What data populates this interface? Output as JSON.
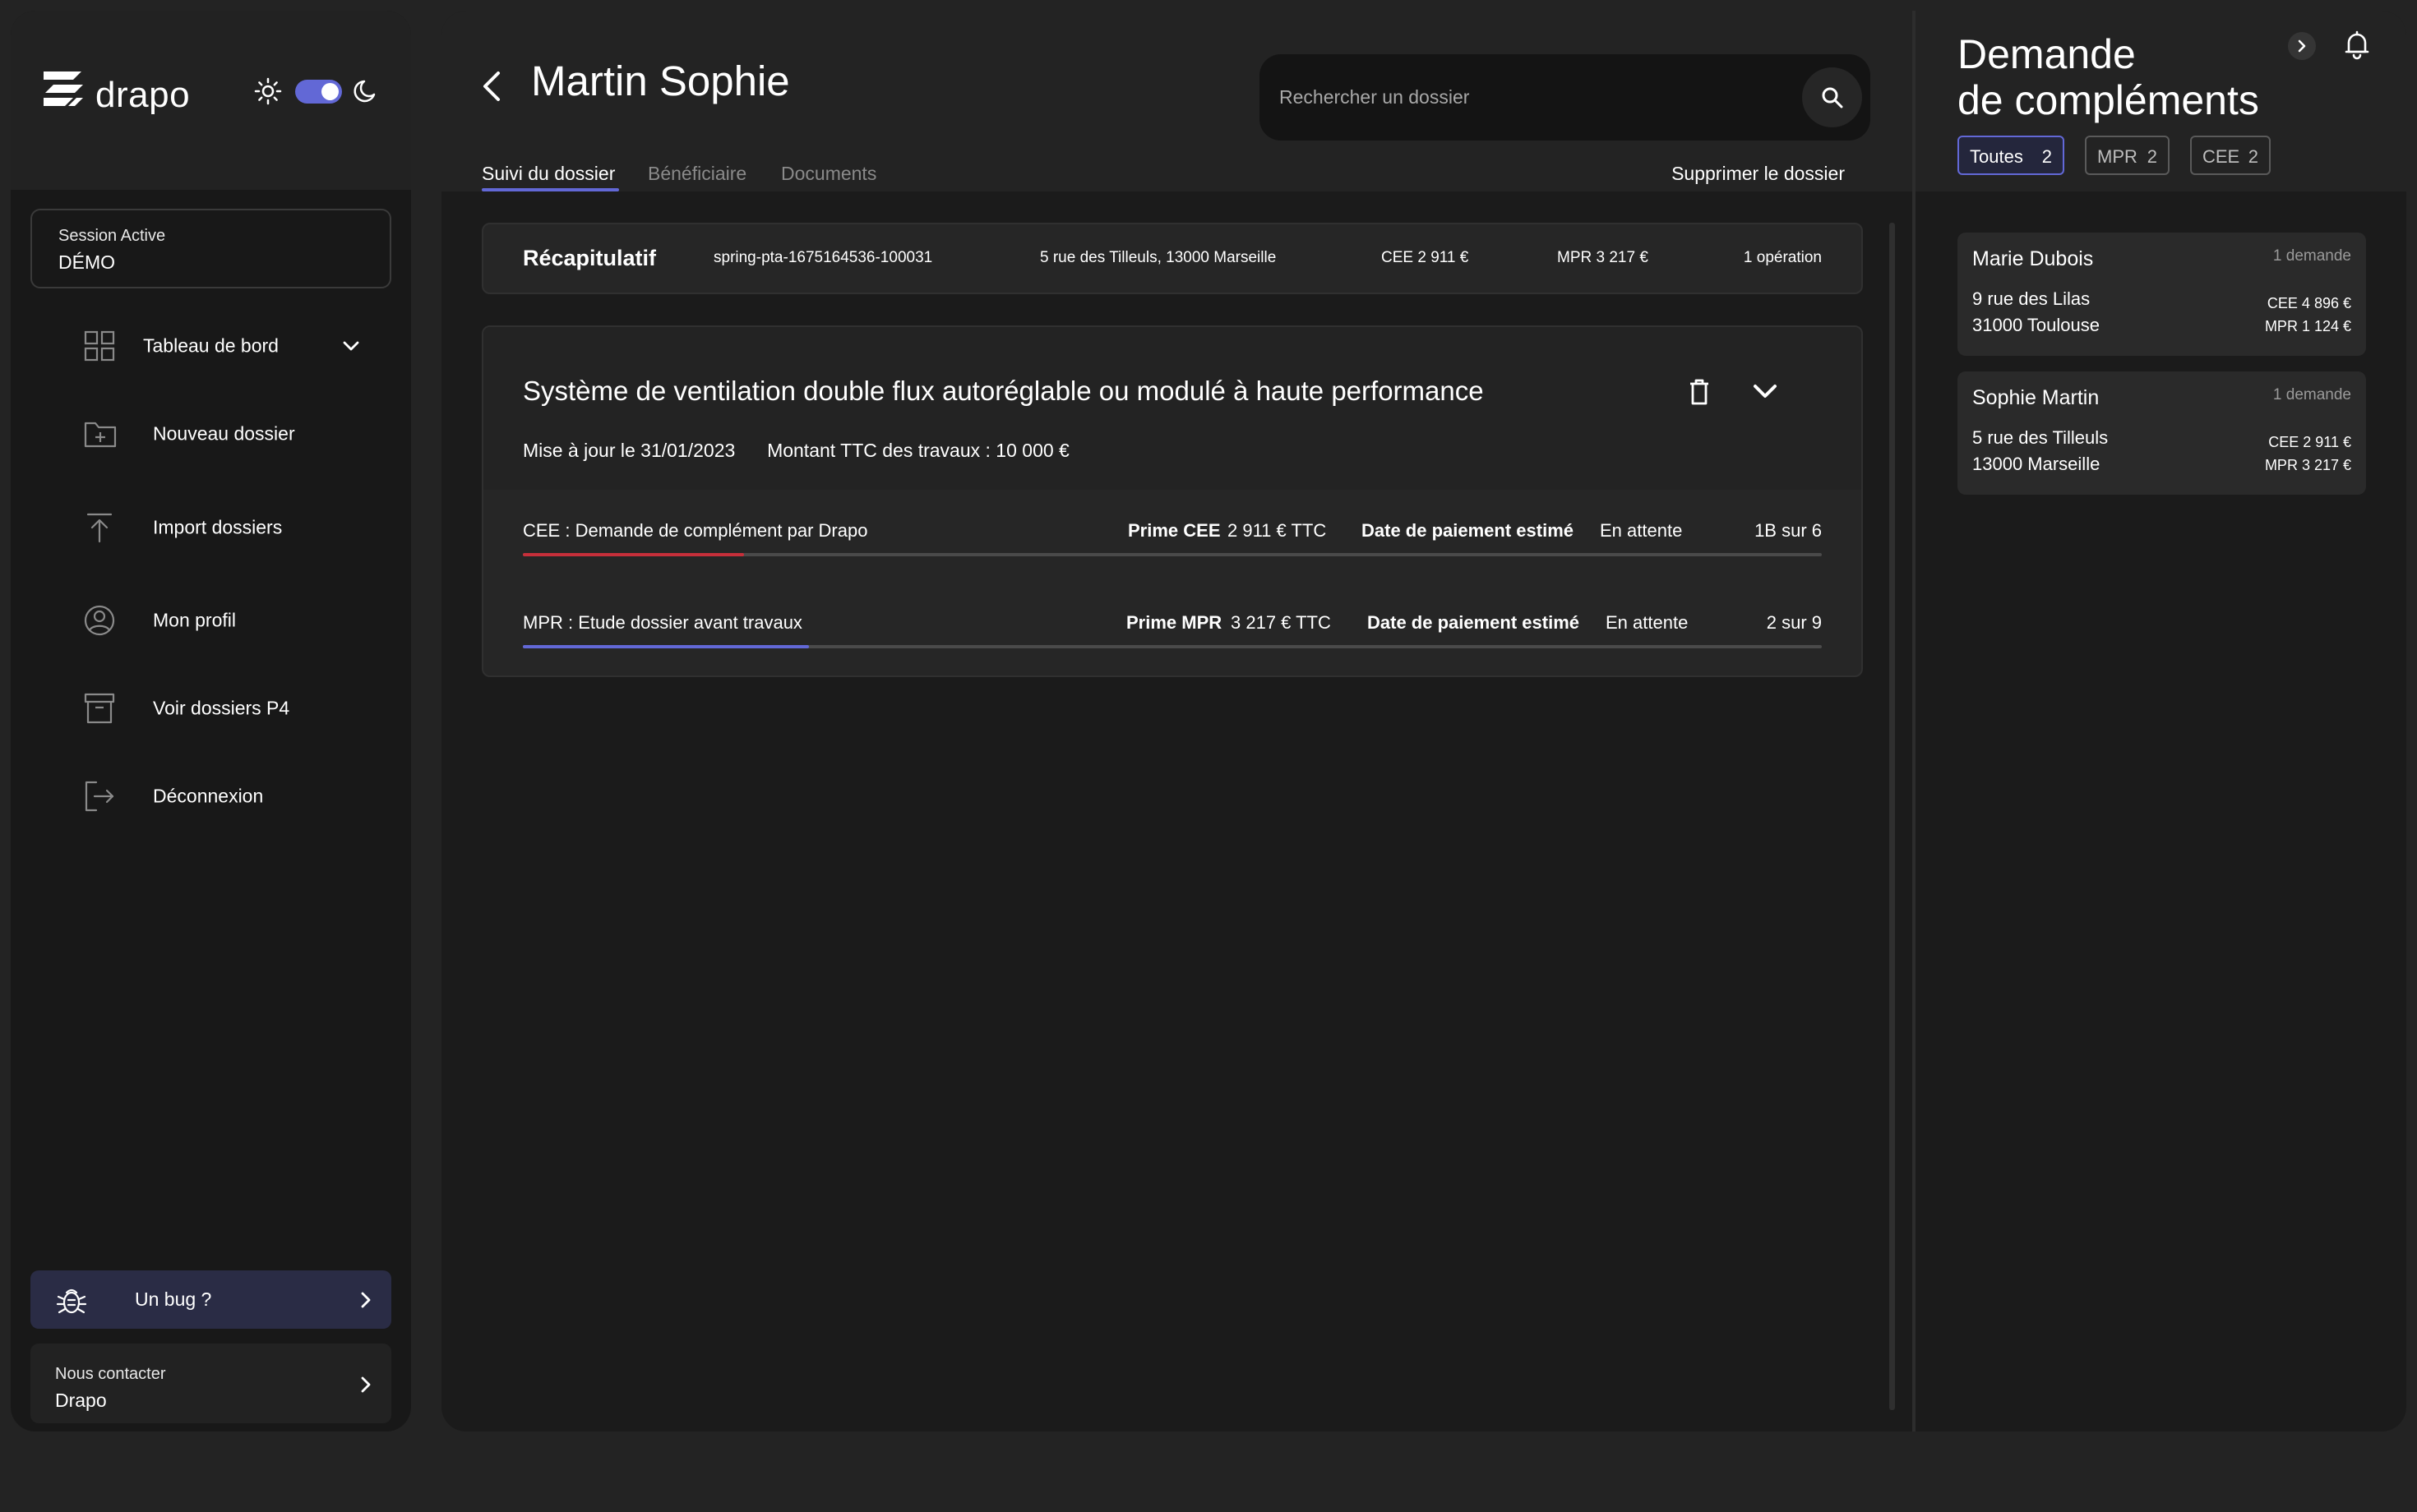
{
  "sidebar": {
    "logo_text": "drapo",
    "session": {
      "label": "Session Active",
      "value": "DÉMO"
    },
    "nav": [
      {
        "label": "Tableau de bord",
        "icon": "grid-icon"
      },
      {
        "label": "Nouveau dossier",
        "icon": "folder-plus-icon"
      },
      {
        "label": "Import dossiers",
        "icon": "upload-icon"
      },
      {
        "label": "Mon profil",
        "icon": "user-circle-icon"
      },
      {
        "label": "Voir dossiers P4",
        "icon": "archive-icon"
      },
      {
        "label": "Déconnexion",
        "icon": "logout-icon"
      }
    ],
    "bug": {
      "label": "Un bug ?"
    },
    "contact": {
      "label": "Nous contacter",
      "value": "Drapo"
    }
  },
  "main": {
    "title": "Martin Sophie",
    "search": {
      "placeholder": "Rechercher un dossier",
      "value": ""
    },
    "tabs": [
      "Suivi du dossier",
      "Bénéficiaire",
      "Documents"
    ],
    "active_tab": "Suivi du dossier",
    "delete_label": "Supprimer le dossier",
    "recap": {
      "title": "Récapitulatif",
      "reference": "spring-pta-1675164536-100031",
      "address": "5 rue des Tilleuls, 13000 Marseille",
      "cee": "CEE 2 911 €",
      "mpr": "MPR 3 217 €",
      "operations": "1 opération"
    },
    "operation": {
      "title": "Système de ventilation double flux autoréglable ou modulé à haute performance",
      "updated": "Mise à jour le 31/01/2023",
      "amount": "Montant TTC des travaux : 10 000 €",
      "steps": [
        {
          "name": "CEE : Demande de complément par Drapo",
          "prime_label": "Prime CEE",
          "prime_value": "2 911 € TTC",
          "date_label": "Date de paiement estimé",
          "date_value": "En attente",
          "progress": "1B sur 6",
          "progress_fraction": 0.17,
          "color": "#c62f3a"
        },
        {
          "name": "MPR : Etude dossier avant travaux",
          "prime_label": "Prime MPR",
          "prime_value": "3 217 € TTC",
          "date_label": "Date de paiement estimé",
          "date_value": "En attente",
          "progress": "2 sur 9",
          "progress_fraction": 0.22,
          "color": "#6268d6"
        }
      ]
    }
  },
  "right_panel": {
    "title_line1": "Demande",
    "title_line2": "de compléments",
    "filters": [
      {
        "label": "Toutes",
        "count": "2",
        "active": true
      },
      {
        "label": "MPR",
        "count": "2",
        "active": false
      },
      {
        "label": "CEE",
        "count": "2",
        "active": false
      }
    ],
    "requests": [
      {
        "name": "Marie Dubois",
        "count": "1 demande",
        "address_line1": "9 rue des Lilas",
        "address_line2": "31000 Toulouse",
        "cee": "CEE 4 896 €",
        "mpr": "MPR 1 124 €"
      },
      {
        "name": "Sophie Martin",
        "count": "1 demande",
        "address_line1": "5 rue des Tilleuls",
        "address_line2": "13000 Marseille",
        "cee": "CEE 2 911 €",
        "mpr": "MPR 3 217 €"
      }
    ]
  },
  "colors": {
    "accent": "#6268d6",
    "cee_progress": "#c62f3a",
    "background": "#232323",
    "panel": "#1b1b1b"
  }
}
